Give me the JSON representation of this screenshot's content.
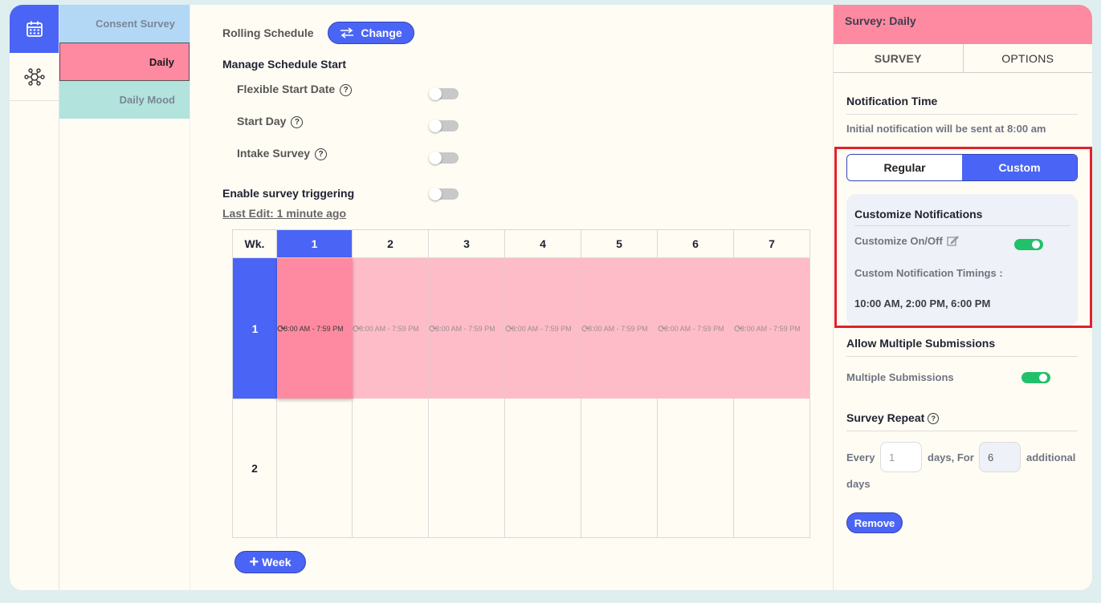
{
  "rail": {
    "icons": [
      "calendar-icon",
      "network-icon"
    ]
  },
  "surveys": [
    {
      "label": "Consent Survey"
    },
    {
      "label": "Daily"
    },
    {
      "label": "Daily Mood"
    }
  ],
  "schedule": {
    "rolling_label": "Rolling Schedule",
    "change_label": "Change",
    "manage_label": "Manage Schedule Start",
    "flexible_label": "Flexible Start Date",
    "start_day_label": "Start Day",
    "intake_label": "Intake Survey",
    "trigger_label": "Enable survey triggering",
    "last_edit": "Last Edit: 1 minute ago",
    "help_glyph": "?"
  },
  "grid": {
    "wk_header": "Wk.",
    "days": [
      "1",
      "2",
      "3",
      "4",
      "5",
      "6",
      "7"
    ],
    "weeks": [
      "1",
      "2"
    ],
    "slot_selected": "8:00 AM - 7:59 PM",
    "slot_text": "8:00 AM - 7:59 PM",
    "add_week_label": "Week"
  },
  "panel": {
    "title": "Survey: Daily",
    "tab_survey": "SURVEY",
    "tab_options": "OPTIONS",
    "notif_title": "Notification Time",
    "notif_text": "Initial notification will be sent at 8:00 am",
    "seg_regular": "Regular",
    "seg_custom": "Custom",
    "customize_title": "Customize Notifications",
    "customize_onoff": "Customize On/Off",
    "custom_timings_label": "Custom Notification Timings :",
    "custom_timings_value": "10:00 AM, 2:00 PM, 6:00 PM",
    "multi_title": "Allow Multiple Submissions",
    "multi_label": "Multiple Submissions",
    "repeat_title": "Survey Repeat",
    "every_label": "Every",
    "every_value": "1",
    "days_for_label": "days, For",
    "for_value": "6",
    "additional_label": "additional",
    "days_label": "days",
    "remove_label": "Remove"
  },
  "colors": {
    "accent": "#4a65f5",
    "daily": "#fd8aa0",
    "toggle_on": "#22c06a",
    "highlight": "#e0212b"
  }
}
